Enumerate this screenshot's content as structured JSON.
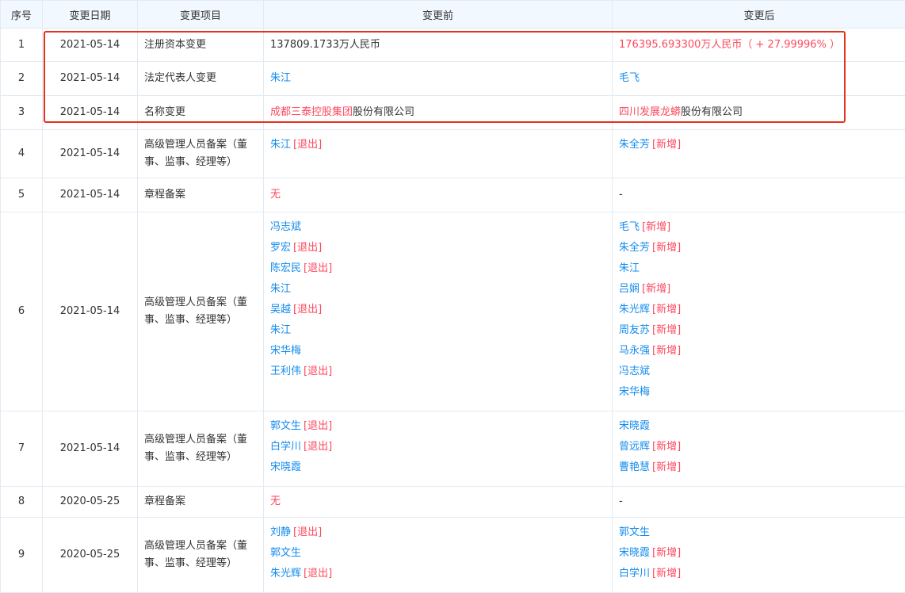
{
  "headers": {
    "index": "序号",
    "date": "变更日期",
    "item": "变更项目",
    "before": "变更前",
    "after": "变更后"
  },
  "rows": [
    {
      "index": "1",
      "date": "2021-05-14",
      "item": "注册资本变更",
      "before_text": "137809.1733万人民币",
      "after_text": "176395.693300万人民币（ + 27.99996% ）"
    },
    {
      "index": "2",
      "date": "2021-05-14",
      "item": "法定代表人变更",
      "before_name": "朱江",
      "after_name": "毛飞"
    },
    {
      "index": "3",
      "date": "2021-05-14",
      "item": "名称变更",
      "before_hl": "成都三泰控股集团",
      "before_rest": "股份有限公司",
      "after_hl": "四川发展龙蟒",
      "after_rest": "股份有限公司"
    },
    {
      "index": "4",
      "date": "2021-05-14",
      "item": "高级管理人员备案（董事、监事、经理等）",
      "before": [
        {
          "name": "朱江",
          "tag": "[退出]"
        }
      ],
      "after": [
        {
          "name": "朱全芳",
          "tag": "[新增]"
        }
      ]
    },
    {
      "index": "5",
      "date": "2021-05-14",
      "item": "章程备案",
      "before_text": "无",
      "after_text": "-"
    },
    {
      "index": "6",
      "date": "2021-05-14",
      "item": "高级管理人员备案（董事、监事、经理等）",
      "before": [
        {
          "name": "冯志斌",
          "tag": ""
        },
        {
          "name": "罗宏",
          "tag": "[退出]"
        },
        {
          "name": "陈宏民",
          "tag": "[退出]"
        },
        {
          "name": "朱江",
          "tag": ""
        },
        {
          "name": "吴越",
          "tag": "[退出]"
        },
        {
          "name": "朱江",
          "tag": ""
        },
        {
          "name": "宋华梅",
          "tag": ""
        },
        {
          "name": "王利伟",
          "tag": "[退出]"
        }
      ],
      "after": [
        {
          "name": "毛飞",
          "tag": "[新增]"
        },
        {
          "name": "朱全芳",
          "tag": "[新增]"
        },
        {
          "name": "朱江",
          "tag": ""
        },
        {
          "name": "吕娴",
          "tag": "[新增]"
        },
        {
          "name": "朱光辉",
          "tag": "[新增]"
        },
        {
          "name": "周友苏",
          "tag": "[新增]"
        },
        {
          "name": "马永强",
          "tag": "[新增]"
        },
        {
          "name": "冯志斌",
          "tag": ""
        },
        {
          "name": "宋华梅",
          "tag": ""
        }
      ]
    },
    {
      "index": "7",
      "date": "2021-05-14",
      "item": "高级管理人员备案（董事、监事、经理等）",
      "before": [
        {
          "name": "郭文生",
          "tag": "[退出]"
        },
        {
          "name": "白学川",
          "tag": "[退出]"
        },
        {
          "name": "宋晓霞",
          "tag": ""
        }
      ],
      "after": [
        {
          "name": "宋晓霞",
          "tag": ""
        },
        {
          "name": "曾远辉",
          "tag": "[新增]"
        },
        {
          "name": "曹艳慧",
          "tag": "[新增]"
        }
      ]
    },
    {
      "index": "8",
      "date": "2020-05-25",
      "item": "章程备案",
      "before_text": "无",
      "after_text": "-"
    },
    {
      "index": "9",
      "date": "2020-05-25",
      "item": "高级管理人员备案（董事、监事、经理等）",
      "before": [
        {
          "name": "刘静",
          "tag": "[退出]"
        },
        {
          "name": "郭文生",
          "tag": ""
        },
        {
          "name": "朱光辉",
          "tag": "[退出]"
        }
      ],
      "after": [
        {
          "name": "郭文生",
          "tag": ""
        },
        {
          "name": "宋晓霞",
          "tag": "[新增]"
        },
        {
          "name": "白学川",
          "tag": "[新增]"
        }
      ]
    }
  ],
  "colors": {
    "link_blue": "#128bed",
    "tag_red": "#fd485e",
    "highlight_border": "#e5311f",
    "header_bg": "#f2f8ff"
  }
}
